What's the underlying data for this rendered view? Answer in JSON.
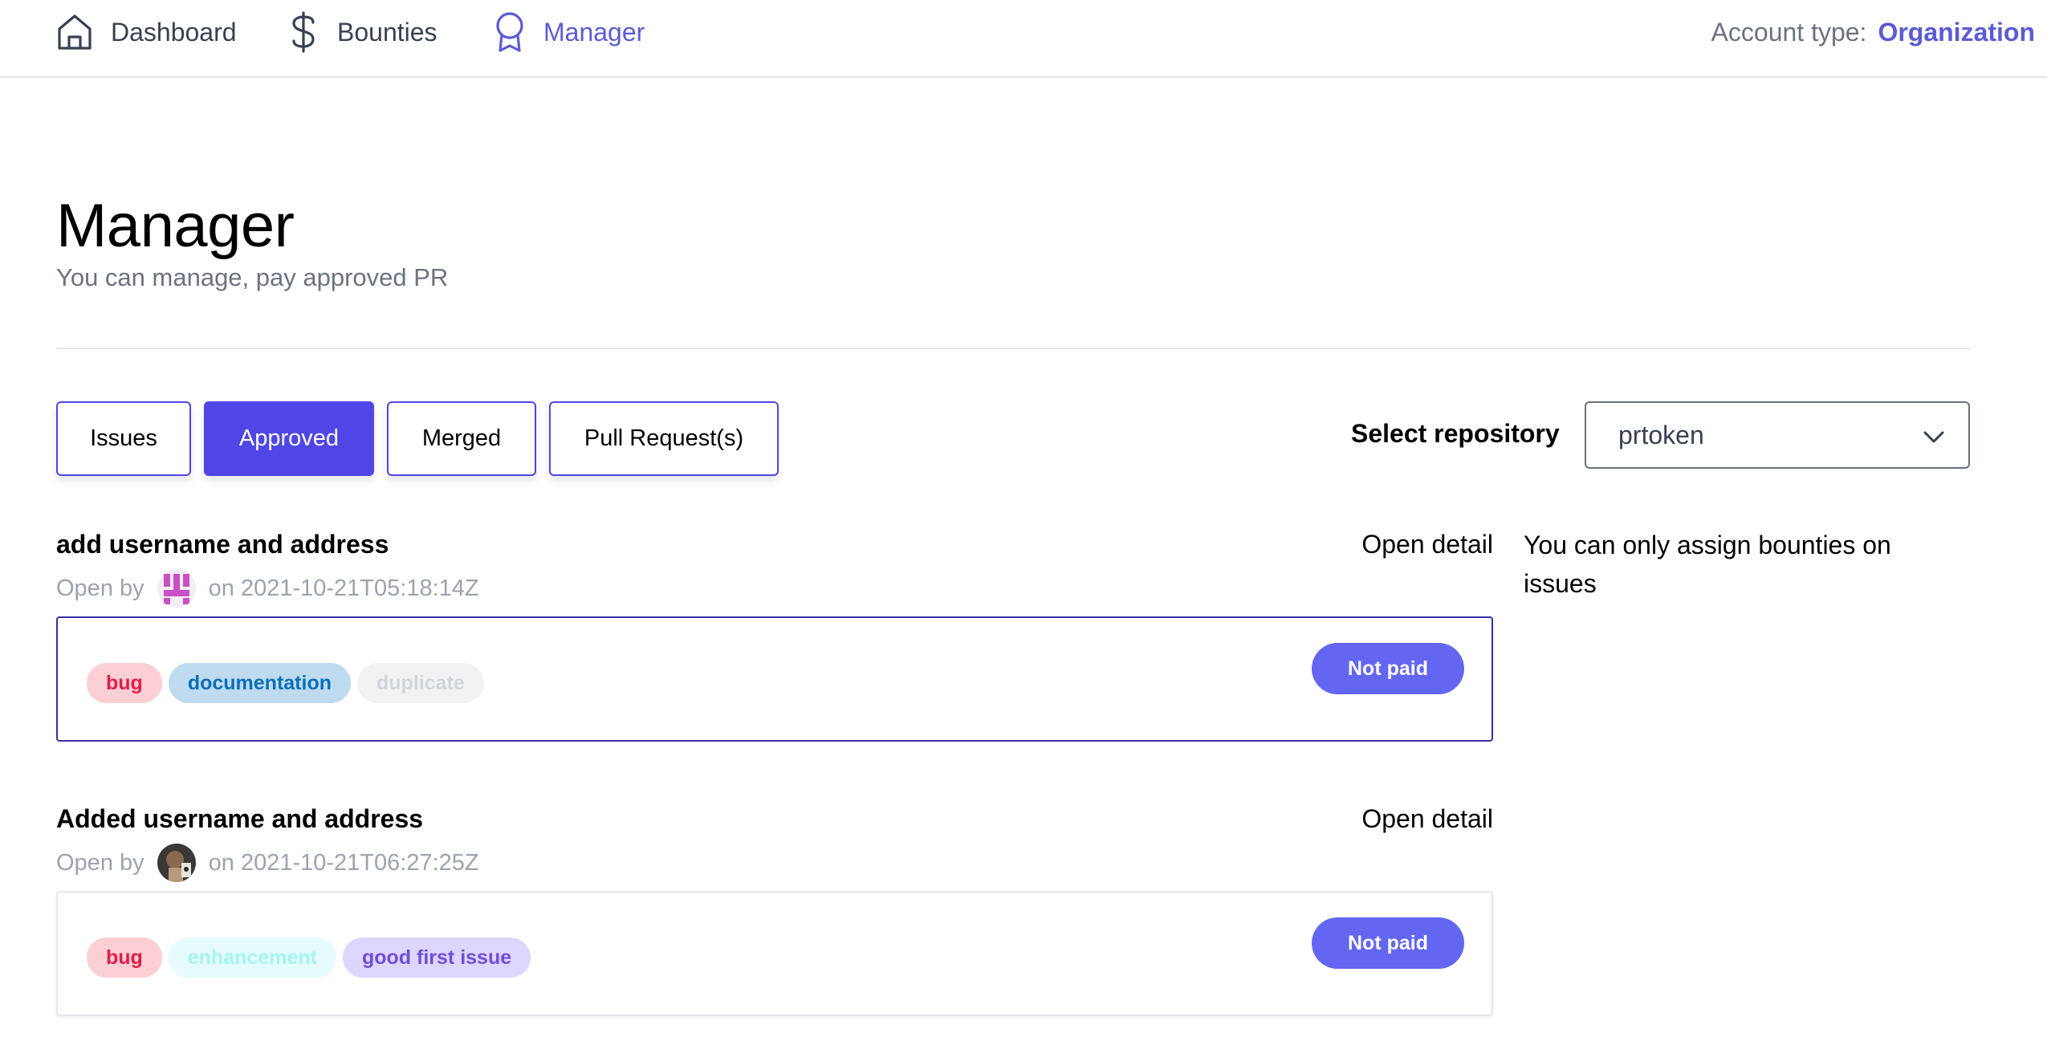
{
  "nav": {
    "items": [
      {
        "label": "Dashboard",
        "icon": "home-icon"
      },
      {
        "label": "Bounties",
        "icon": "dollar-icon"
      },
      {
        "label": "Manager",
        "icon": "badge-icon",
        "active": true
      }
    ],
    "account_label": "Account type:",
    "account_value": "Organization"
  },
  "page": {
    "title": "Manager",
    "subtitle": "You can manage, pay approved PR"
  },
  "tabs": [
    {
      "label": "Issues",
      "active": false
    },
    {
      "label": "Approved",
      "active": true
    },
    {
      "label": "Merged",
      "active": false
    },
    {
      "label": "Pull Request(s)",
      "active": false
    }
  ],
  "repo": {
    "label": "Select repository",
    "selected": "prtoken"
  },
  "issues": [
    {
      "title": "add username and address",
      "open_detail": "Open detail",
      "open_by": "Open by",
      "date": "on 2021-10-21T05:18:14Z",
      "labels": [
        {
          "text": "bug",
          "bg": "#fbcfd4",
          "fg": "#e11d48"
        },
        {
          "text": "documentation",
          "bg": "#bfdbf0",
          "fg": "#0b6fb8"
        },
        {
          "text": "duplicate",
          "bg": "#f1f2f4",
          "fg": "#d1d5db"
        }
      ],
      "status": "Not paid"
    },
    {
      "title": "Added username and address",
      "open_detail": "Open detail",
      "open_by": "Open by",
      "date": "on 2021-10-21T06:27:25Z",
      "labels": [
        {
          "text": "bug",
          "bg": "#fbcfd4",
          "fg": "#e11d48"
        },
        {
          "text": "enhancement",
          "bg": "#e6fbfb",
          "fg": "#a5f3f3"
        },
        {
          "text": "good first issue",
          "bg": "#ddd6fe",
          "fg": "#6d4fd8"
        }
      ],
      "status": "Not paid"
    }
  ],
  "side_note": "You can only assign bounties on issues",
  "colors": {
    "accent": "#4f46e5",
    "nav_active": "#5b5bd6",
    "status_button": "#6366f1"
  }
}
